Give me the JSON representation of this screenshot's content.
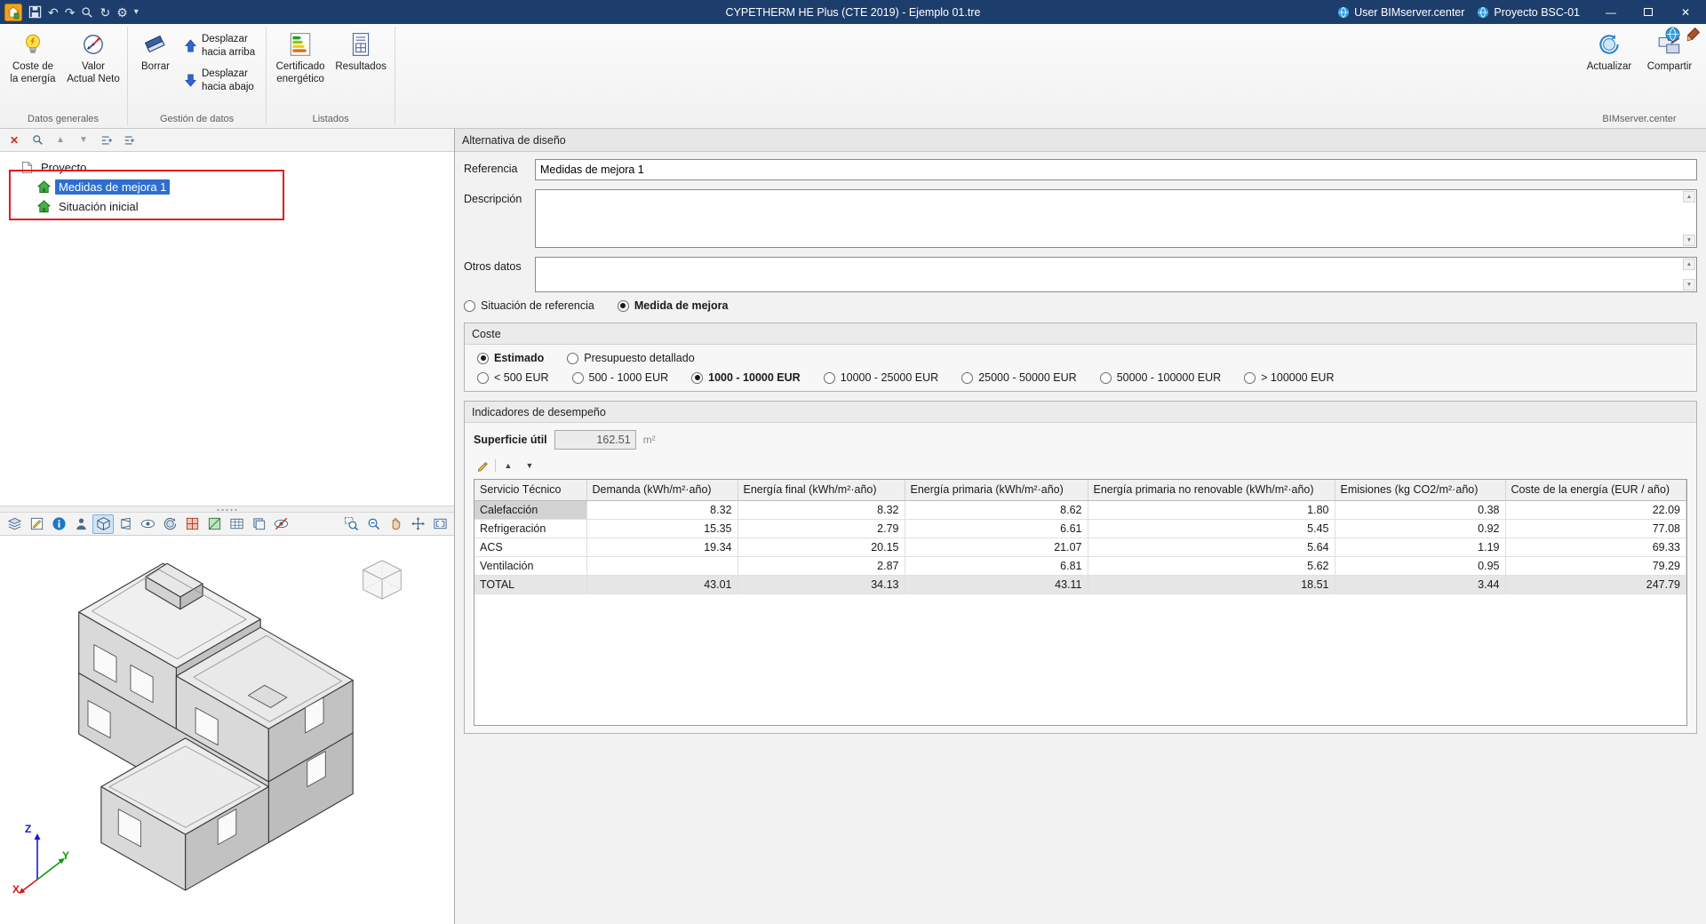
{
  "titlebar": {
    "title": "CYPETHERM HE Plus (CTE 2019) - Ejemplo 01.tre",
    "user": "User BIMserver.center",
    "project": "Proyecto BSC-01"
  },
  "glyphs": {
    "close": "✕",
    "minimize": "—",
    "undo": "↶",
    "redo": "↷",
    "refresh": "↻",
    "gear": "⚙",
    "caret": "▾",
    "up": "▲",
    "down": "▼"
  },
  "ribbon": {
    "buttons": {
      "coste_energia": "Coste de\nla energía",
      "valor_neto": "Valor\nActual Neto",
      "borrar": "Borrar",
      "desplazar_arriba": "Desplazar\nhacia arriba",
      "desplazar_abajo": "Desplazar\nhacia abajo",
      "certificado": "Certificado\nenergético",
      "resultados": "Resultados",
      "actualizar": "Actualizar",
      "compartir": "Compartir"
    },
    "groups": {
      "datos_generales": "Datos generales",
      "gestion_datos": "Gestión de datos",
      "listados": "Listados",
      "bimserver": "BIMserver.center"
    }
  },
  "tree": {
    "root": "Proyecto",
    "items": [
      {
        "label": "Medidas de mejora 1",
        "selected": true
      },
      {
        "label": "Situación inicial",
        "selected": false
      }
    ]
  },
  "viewport": {
    "axes": {
      "x": "X",
      "y": "Y",
      "z": "Z"
    }
  },
  "panel": {
    "header": "Alternativa de diseño",
    "referencia_label": "Referencia",
    "referencia_value": "Medidas de mejora 1",
    "descripcion_label": "Descripción",
    "otros_label": "Otros datos",
    "radio_situacion": "Situación de referencia",
    "radio_medida": "Medida de mejora"
  },
  "coste": {
    "title": "Coste",
    "estimado": "Estimado",
    "presupuesto": "Presupuesto detallado",
    "selected_mode": "Estimado",
    "selected_range": "1000 - 10000 EUR",
    "ranges": [
      {
        "label": "< 500 EUR",
        "selected": false
      },
      {
        "label": "500 - 1000 EUR",
        "selected": false
      },
      {
        "label": "1000 - 10000 EUR",
        "selected": true
      },
      {
        "label": "10000 - 25000 EUR",
        "selected": false
      },
      {
        "label": "25000 - 50000 EUR",
        "selected": false
      },
      {
        "label": "50000 - 100000 EUR",
        "selected": false
      },
      {
        "label": "> 100000 EUR",
        "selected": false
      }
    ]
  },
  "indicadores": {
    "title": "Indicadores de desempeño",
    "superficie_label": "Superficie útil",
    "superficie_value": "162.51",
    "superficie_unit": "m²",
    "table": {
      "headers": [
        "Servicio Técnico",
        "Demanda (kWh/m²·año)",
        "Energía final (kWh/m²·año)",
        "Energía primaria (kWh/m²·año)",
        "Energía primaria no renovable (kWh/m²·año)",
        "Emisiones (kg CO2/m²·año)",
        "Coste de la energía (EUR / año)"
      ],
      "rows": [
        [
          "Calefacción",
          "8.32",
          "8.32",
          "8.62",
          "1.80",
          "0.38",
          "22.09"
        ],
        [
          "Refrigeración",
          "15.35",
          "2.79",
          "6.61",
          "5.45",
          "0.92",
          "77.08"
        ],
        [
          "ACS",
          "19.34",
          "20.15",
          "21.07",
          "5.64",
          "1.19",
          "69.33"
        ],
        [
          "Ventilación",
          "",
          "2.87",
          "6.81",
          "5.62",
          "0.95",
          "79.29"
        ],
        [
          "TOTAL",
          "43.01",
          "34.13",
          "43.11",
          "18.51",
          "3.44",
          "247.79"
        ]
      ]
    }
  }
}
